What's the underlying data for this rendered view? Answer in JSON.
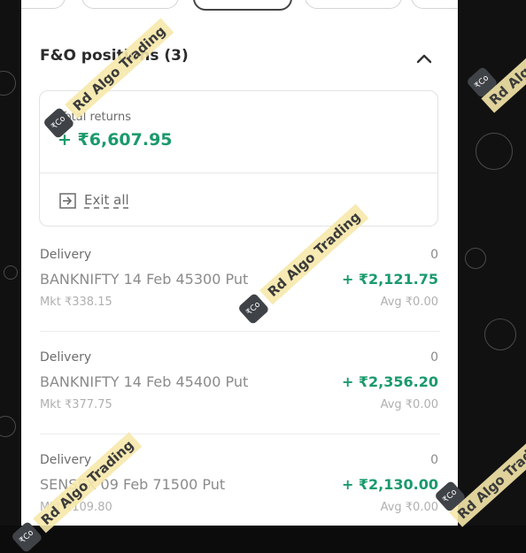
{
  "positions_section": {
    "title": "F&O positions (3)",
    "collapse_icon": "chevron-up-icon"
  },
  "summary": {
    "returns_label": "Total returns",
    "returns_value": "+ ₹6,607.95",
    "exit_label": "Exit all",
    "exit_icon": "exit-arrow-icon"
  },
  "positions": [
    {
      "type": "Delivery",
      "qty": "0",
      "instrument": "BANKNIFTY 14 Feb 45300 Put",
      "pnl": "+ ₹2,121.75",
      "ltp": "Mkt ₹338.15",
      "avg": "Avg ₹0.00"
    },
    {
      "type": "Delivery",
      "qty": "0",
      "instrument": "BANKNIFTY 14 Feb 45400 Put",
      "pnl": "+ ₹2,356.20",
      "ltp": "Mkt ₹377.75",
      "avg": "Avg ₹0.00"
    },
    {
      "type": "Delivery",
      "qty": "0",
      "instrument": "SENSEX 09 Feb 71500 Put",
      "pnl": "+ ₹2,130.00",
      "ltp": "Mkt ₹109.80",
      "avg": "Avg ₹0.00"
    }
  ],
  "watermark": {
    "text": "Rd Algo Trading",
    "logo": "₹Co"
  },
  "colors": {
    "profit": "#1a9a6c",
    "background": "#ffffff",
    "watermark_band": "#f6e8aa"
  }
}
